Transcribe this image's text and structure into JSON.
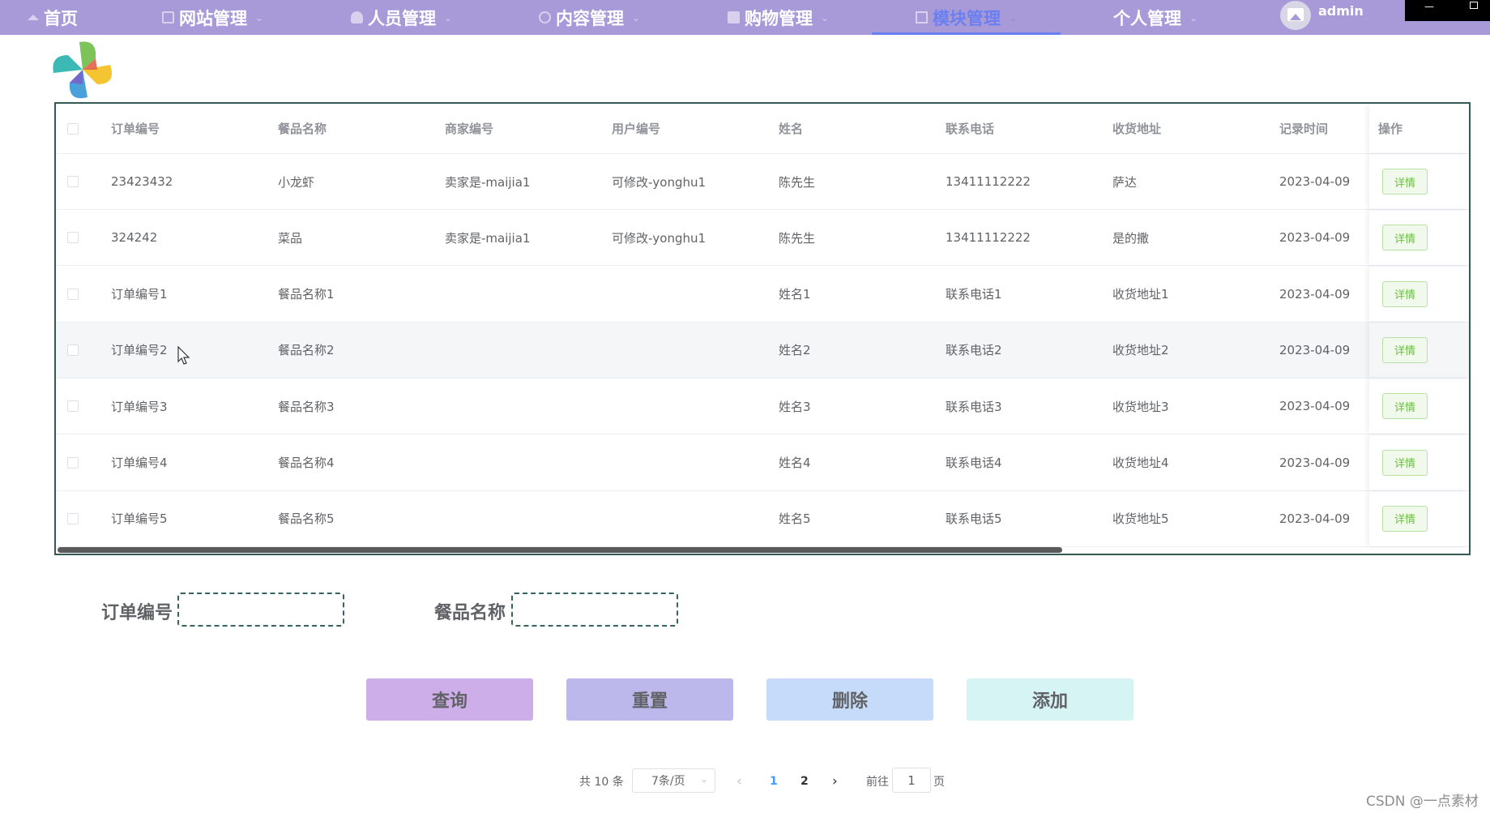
{
  "nav": {
    "items": [
      {
        "label": "首页",
        "icon": "home-icon"
      },
      {
        "label": "网站管理",
        "icon": "monitor-icon"
      },
      {
        "label": "人员管理",
        "icon": "user-icon"
      },
      {
        "label": "内容管理",
        "icon": "chat-icon"
      },
      {
        "label": "购物管理",
        "icon": "bag-icon"
      },
      {
        "label": "模块管理",
        "icon": "copy-icon"
      },
      {
        "label": "个人管理",
        "icon": ""
      }
    ],
    "active": "模块管理",
    "user": "admin"
  },
  "table": {
    "columns": [
      "订单编号",
      "餐品名称",
      "商家编号",
      "用户编号",
      "姓名",
      "联系电话",
      "收货地址",
      "记录时间",
      "操作"
    ],
    "rows": [
      [
        "23423432",
        "小龙虾",
        "卖家是-maijia1",
        "可修改-yonghu1",
        "陈先生",
        "13411112222",
        "萨达",
        "2023-04-09"
      ],
      [
        "324242",
        "菜品",
        "卖家是-maijia1",
        "可修改-yonghu1",
        "陈先生",
        "13411112222",
        "是的撒",
        "2023-04-09"
      ],
      [
        "订单编号1",
        "餐品名称1",
        "",
        "",
        "姓名1",
        "联系电话1",
        "收货地址1",
        "2023-04-09"
      ],
      [
        "订单编号2",
        "餐品名称2",
        "",
        "",
        "姓名2",
        "联系电话2",
        "收货地址2",
        "2023-04-09"
      ],
      [
        "订单编号3",
        "餐品名称3",
        "",
        "",
        "姓名3",
        "联系电话3",
        "收货地址3",
        "2023-04-09"
      ],
      [
        "订单编号4",
        "餐品名称4",
        "",
        "",
        "姓名4",
        "联系电话4",
        "收货地址4",
        "2023-04-09"
      ],
      [
        "订单编号5",
        "餐品名称5",
        "",
        "",
        "姓名5",
        "联系电话5",
        "收货地址5",
        "2023-04-09"
      ]
    ],
    "detail_label": "详情"
  },
  "search": {
    "order_label": "订单编号",
    "order_value": "",
    "meal_label": "餐品名称",
    "meal_value": ""
  },
  "actions": {
    "query": "查询",
    "reset": "重置",
    "delete": "删除",
    "add": "添加"
  },
  "colors": {
    "nav_bg": "#a89ad9",
    "nav_active": "#6a7ff0",
    "query_bg": "#cdaee8",
    "reset_bg": "#bcb8ec",
    "delete_bg": "#c6dbfa",
    "add_bg": "#d7f4f5",
    "detail_bg": "#f0f9eb",
    "detail_text": "#67c23a"
  },
  "pagination": {
    "total": "共 10 条",
    "page_size": "7条/页",
    "pages": [
      "1",
      "2"
    ],
    "current_page": "1",
    "goto_prefix": "前往",
    "goto_value": "1",
    "goto_suffix": "页"
  },
  "watermark": "CSDN @一点素材"
}
